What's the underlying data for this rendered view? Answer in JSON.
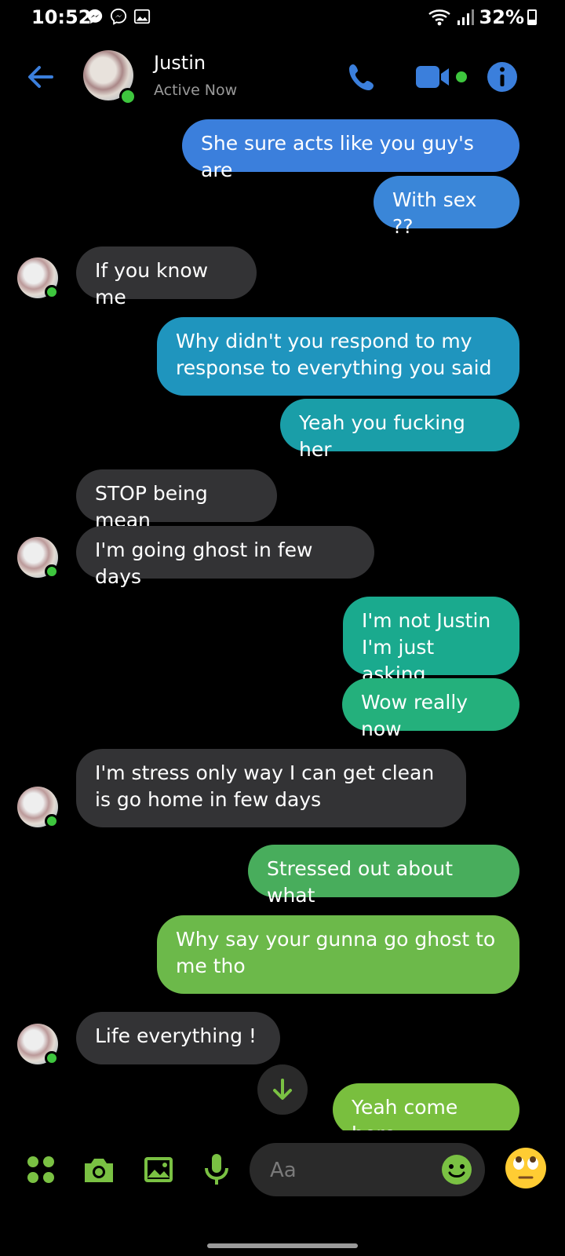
{
  "status_bar": {
    "time": "10:52",
    "battery": "32%",
    "battery_level": 0.32
  },
  "header": {
    "contact_name": "Justin",
    "contact_status": "Active Now"
  },
  "messages": [
    {
      "sender": "me",
      "text": "She sure acts like you guy's are",
      "color": "#3b7fdc"
    },
    {
      "sender": "me",
      "text": "With sex ??",
      "color": "#3a86d8"
    },
    {
      "sender": "Justin",
      "text": "If you know me",
      "color": "#333335"
    },
    {
      "sender": "me",
      "text": "Why didn't you respond to my response to everything you said",
      "color": "#1f95be"
    },
    {
      "sender": "me",
      "text": "Yeah you fucking her",
      "color": "#1a9ea8"
    },
    {
      "sender": "Justin",
      "text": "STOP being mean",
      "color": "#333335"
    },
    {
      "sender": "Justin",
      "text": "I'm going ghost in few days",
      "color": "#333335"
    },
    {
      "sender": "me",
      "text": "I'm not Justin I'm just asking",
      "color": "#1aaa8e"
    },
    {
      "sender": "me",
      "text": "Wow really now",
      "color": "#24b07c"
    },
    {
      "sender": "Justin",
      "text": "I'm stress only way I can get clean is go home in few days",
      "color": "#333335"
    },
    {
      "sender": "me",
      "text": "Stressed out about what",
      "color": "#48ad5c"
    },
    {
      "sender": "me",
      "text": "Why say your gunna go ghost to me tho",
      "color": "#6cb94a"
    },
    {
      "sender": "Justin",
      "text": "Life everything !",
      "color": "#333335"
    },
    {
      "sender": "me",
      "text": "Yeah come here",
      "color": "#79bf3e"
    }
  ],
  "composer": {
    "placeholder": "Aa"
  },
  "colors": {
    "accent_blue": "#3b7fdc",
    "accent_green": "#7ac143",
    "online": "#3ec63e",
    "incoming_bubble": "#333335"
  },
  "icons": [
    "back-arrow-icon",
    "phone-icon",
    "video-camera-icon",
    "info-icon",
    "apps-icon",
    "camera-icon",
    "gallery-icon",
    "microphone-icon",
    "emoji-icon",
    "rolling-eyes-emoji-icon",
    "arrow-down-icon"
  ]
}
